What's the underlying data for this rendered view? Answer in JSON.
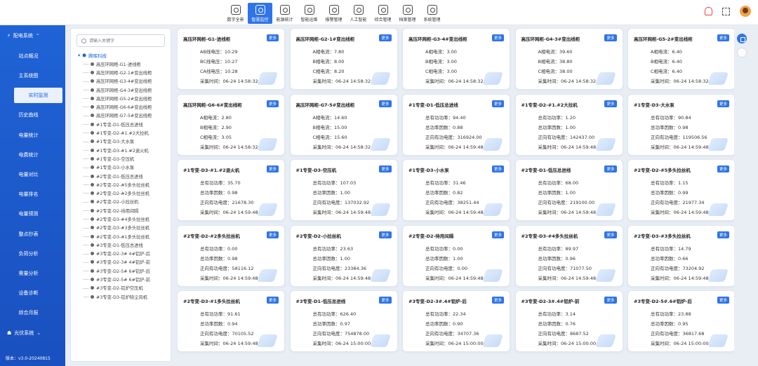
{
  "nav": [
    {
      "label": "数字全景",
      "icon": "panorama-icon"
    },
    {
      "label": "智慧监控",
      "icon": "bar-chart-icon",
      "active": true
    },
    {
      "label": "能源统计",
      "icon": "energy-icon"
    },
    {
      "label": "智能运维",
      "icon": "gear-icon"
    },
    {
      "label": "报警管理",
      "icon": "alarm-icon"
    },
    {
      "label": "人工智能",
      "icon": "ai-icon"
    },
    {
      "label": "综合管理",
      "icon": "grid-icon"
    },
    {
      "label": "档案管理",
      "icon": "archive-icon"
    },
    {
      "label": "系统管理",
      "icon": "system-icon"
    }
  ],
  "sidebar": {
    "group1": "配电系统",
    "items": [
      "站点概况",
      "主系统图",
      "实时监测",
      "历史曲线",
      "电量统计",
      "电费统计",
      "电量对比",
      "电量排名",
      "电量预测",
      "整点抄表",
      "负荷分析",
      "需量分析",
      "设备诊断",
      "综合月报"
    ],
    "active_index": 2,
    "group2": "光伏系统",
    "version": "版本：v3.0-20240815"
  },
  "tree": {
    "search_placeholder": "请输入关键字",
    "root": "腾晖科技",
    "nodes": [
      "高压环网柜-G1-进线柜",
      "高压环网柜-G2-1#变出线柜",
      "高压环网柜-G3-4#变出线柜",
      "高压环网柜-G4-3#变出线柜",
      "高压环网柜-G5-2#变出线柜",
      "高压环网柜-G6-6#变出线柜",
      "高压环网柜-G7-5#变出线柜",
      "#1专变-D1-低压总进线",
      "#1专变-D2-#1.#2大拉机",
      "#1专变-D3-大水泵",
      "#1专变-D3-#1.#2退火机",
      "#1专变-D3-空压机",
      "#1专变-D3-小水泵",
      "#2专变-D1-低压总进线",
      "#2专变-D2-#5多头拉丝机",
      "#2专变-D2-#2多头拉丝机",
      "#2专变-D2-小拉丝机",
      "#2专变-D2-待用间隔",
      "#2专变-D3-#4多头拉丝机",
      "#2专变-D3-#3多头拉丝机",
      "#2专变-D3-#1多头拉丝机",
      "#3专变-D1-低压总进线",
      "#3专变-D2-3# 4#铝炉-后",
      "#3专变-D2-3# 4#铝炉-前",
      "#3专变-D2-5# 6#铝炉-后",
      "#3专变-D2-5# 6#铝炉-前",
      "#3专变-D2-铝炉空压机",
      "#3专变-D3-铝炉除尘风机"
    ]
  },
  "more_label": "更多",
  "cards": [
    {
      "title": "高压环网柜-G1-进线柜",
      "rows": [
        "AB线电压：10.29",
        "BC线电压：10.27",
        "CA线电压：10.28",
        "采集时间：06-24 14:58:32"
      ]
    },
    {
      "title": "高压环网柜-G2-1#变出线柜",
      "rows": [
        "A相电流：7.80",
        "B相电流：8.00",
        "C相电流：8.20",
        "采集时间：06-24 14:58:32"
      ]
    },
    {
      "title": "高压环网柜-G3-4#变出线柜",
      "rows": [
        "A相电流：3.00",
        "B相电流：3.00",
        "C相电流：3.00",
        "采集时间：06-24 14:58:32"
      ]
    },
    {
      "title": "高压环网柜-G4-3#变出线柜",
      "rows": [
        "A相电流：39.60",
        "B相电流：38.80",
        "C相电流：38.00",
        "采集时间：06-24 14:58:32"
      ]
    },
    {
      "title": "高压环网柜-G5-2#变出线柜",
      "rows": [
        "A相电流：6.40",
        "B相电流：6.40",
        "C相电流：6.40",
        "采集时间：06-24 14:58:32"
      ]
    },
    {
      "title": "高压环网柜-G6-6#变出线柜",
      "rows": [
        "A相电流：2.80",
        "B相电流：2.90",
        "C相电流：3.05",
        "采集时间：06-24 14:58:32"
      ]
    },
    {
      "title": "高压环网柜-G7-5#变出线柜",
      "rows": [
        "A相电流：14.60",
        "B相电流：15.00",
        "C相电流：15.60",
        "采集时间：06-24 14:58:32"
      ]
    },
    {
      "title": "#1专变-D1-低压总进线",
      "rows": [
        "总有功功率：94.40",
        "总功率因数：0.88",
        "正向有功电度：316924.00",
        "采集时间：06-24 14:59:48"
      ]
    },
    {
      "title": "#1专变-D2-#1.#2大拉机",
      "rows": [
        "总有功功率：1.20",
        "总功率因数：1.00",
        "正向有功电度：142437.00",
        "采集时间：06-24 14:59:48"
      ]
    },
    {
      "title": "#1专变-D3-大水泵",
      "rows": [
        "总有功功率：90.84",
        "总功率因数：0.98",
        "正向有功电度：119506.56",
        "采集时间：06-24 14:59:48"
      ]
    },
    {
      "title": "#1专变-D3-#1.#2退火机",
      "rows": [
        "总有功功率：35.70",
        "总功率因数：0.98",
        "正向有功电度：21678.30",
        "采集时间：06-24 14:59:48"
      ]
    },
    {
      "title": "#1专变-D3-空压机",
      "rows": [
        "总有功功率：107.03",
        "总功率因数：1.00",
        "正向有功电度：137032.92",
        "采集时间：06-24 14:59:48"
      ]
    },
    {
      "title": "#1专变-D3-小水泵",
      "rows": [
        "总有功功率：31.46",
        "总功率因数：0.82",
        "正向有功电度：38251.44",
        "采集时间：06-24 14:59:48"
      ]
    },
    {
      "title": "#2专变-D1-低压总进线",
      "rows": [
        "总有功功率：68.00",
        "总功率因数：1.00",
        "正向有功电度：219100.00",
        "采集时间：06-24 14:59:48"
      ]
    },
    {
      "title": "#2专变-D2-#5多头拉丝机",
      "rows": [
        "总有功功率：1.15",
        "总功率因数：0.99",
        "正向有功电度：21977.34",
        "采集时间：06-24 14:59:48"
      ]
    },
    {
      "title": "#2专变-D2-#2多头拉丝机",
      "rows": [
        "总有功功率：0.00",
        "总功率因数：0.98",
        "正向有功电度：58116.12",
        "采集时间：06-24 14:59:48"
      ]
    },
    {
      "title": "#2专变-D2-小拉丝机",
      "rows": [
        "总有功功率：23.63",
        "总功率因数：1.00",
        "正向有功电度：23384.36",
        "采集时间：06-24 14:59:48"
      ]
    },
    {
      "title": "#2专变-D2-待用间隔",
      "rows": [
        "总有功功率：0.00",
        "总功率因数：1.00",
        "正向有功电度：0.00",
        "采集时间：06-24 14:59:48"
      ]
    },
    {
      "title": "#2专变-D3-#4多头拉丝机",
      "rows": [
        "总有功功率：89.97",
        "总功率因数：0.96",
        "正向有功电度：71077.50",
        "采集时间：06-24 14:59:48"
      ]
    },
    {
      "title": "#2专变-D3-#3多头拉丝机",
      "rows": [
        "总有功功率：14.79",
        "总功率因数：0.66",
        "正向有功电度：73204.92",
        "采集时间：06-24 14:59:48"
      ]
    },
    {
      "title": "#2专变-D3-#1多头拉丝机",
      "rows": [
        "总有功功率：91.61",
        "总功率因数：0.94",
        "正向有功电度：70105.52",
        "采集时间：06-24 14:59:48"
      ]
    },
    {
      "title": "#3专变-D1-低压总进线",
      "rows": [
        "总有功功率：626.40",
        "总功率因数：0.97",
        "正向有功电度：754878.00",
        "采集时间：06-24 15:00:00"
      ]
    },
    {
      "title": "#3专变-D2-3#.4#铝炉-后",
      "rows": [
        "总有功功率：22.34",
        "总功率因数：0.90",
        "正向有功电度：34707.36",
        "采集时间：06-24 15:00:00"
      ]
    },
    {
      "title": "#3专变-D2-3#.4#铝炉-前",
      "rows": [
        "总有功功率：3.14",
        "总功率因数：0.76",
        "正向有功电度：8687.52",
        "采集时间：06-24 15:00:00"
      ]
    },
    {
      "title": "#3专变-D2-5#.6#铝炉-后",
      "rows": [
        "总有功功率：23.88",
        "总功率因数：0.95",
        "正向有功电度：36817.68",
        "采集时间：06-24 15:00:00"
      ]
    }
  ]
}
